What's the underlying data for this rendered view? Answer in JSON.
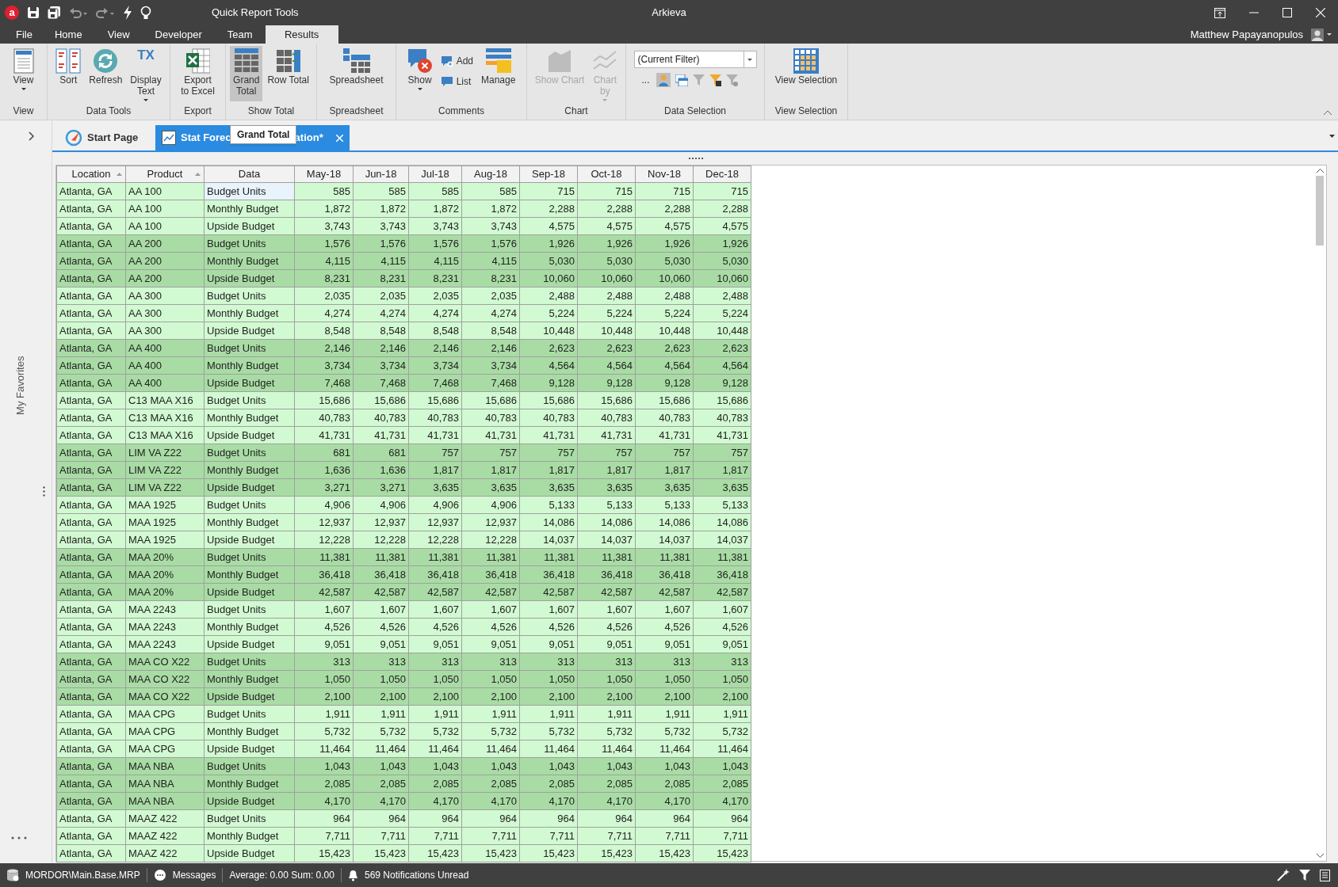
{
  "title_bar": {
    "app_logo": "a",
    "context_title": "Quick Report Tools",
    "title": "Arkieva"
  },
  "menu": [
    {
      "label": "File",
      "selected": false
    },
    {
      "label": "Home",
      "selected": false
    },
    {
      "label": "View",
      "selected": false
    },
    {
      "label": "Developer",
      "selected": false
    },
    {
      "label": "Team",
      "selected": false
    },
    {
      "label": "Results",
      "selected": true
    }
  ],
  "user": {
    "name": "Matthew Papayanopulos"
  },
  "ribbon": [
    {
      "label": "View",
      "buttons": [
        {
          "kind": "large",
          "label": "View",
          "dropdown": true,
          "pressed": false,
          "disabled": false
        }
      ]
    },
    {
      "label": "Data Tools",
      "buttons": [
        {
          "kind": "large",
          "label": "Sort",
          "dropdown": false,
          "pressed": false,
          "disabled": false
        },
        {
          "kind": "large",
          "label": "Refresh",
          "dropdown": false,
          "pressed": false,
          "disabled": false
        },
        {
          "kind": "large",
          "label": "Display\nText",
          "icon_text": "TX",
          "dropdown": true,
          "pressed": false,
          "disabled": false
        }
      ]
    },
    {
      "label": "Export",
      "buttons": [
        {
          "kind": "large",
          "label": "Export\nto Excel",
          "dropdown": false,
          "pressed": false,
          "disabled": false
        }
      ]
    },
    {
      "label": "Show Total",
      "buttons": [
        {
          "kind": "large",
          "label": "Grand\nTotal",
          "dropdown": false,
          "pressed": true,
          "disabled": false
        },
        {
          "kind": "large",
          "label": "Row Total",
          "dropdown": false,
          "pressed": false,
          "disabled": false
        }
      ]
    },
    {
      "label": "Spreadsheet",
      "buttons": [
        {
          "kind": "large",
          "label": "Spreadsheet",
          "dropdown": false,
          "pressed": false,
          "disabled": false
        }
      ]
    },
    {
      "label": "Comments",
      "buttons": [
        {
          "kind": "large",
          "label": "Show",
          "dropdown": true,
          "pressed": false,
          "disabled": false
        },
        {
          "kind": "stack",
          "items": [
            {
              "label": "Add"
            },
            {
              "label": "List"
            }
          ]
        },
        {
          "kind": "large",
          "label": "Manage",
          "dropdown": false,
          "pressed": false,
          "disabled": false
        }
      ]
    },
    {
      "label": "Chart",
      "buttons": [
        {
          "kind": "large",
          "label": "Show Chart",
          "dropdown": false,
          "pressed": false,
          "disabled": true
        },
        {
          "kind": "large",
          "label": "Chart\nby",
          "dropdown": true,
          "pressed": false,
          "disabled": true
        }
      ]
    },
    {
      "label": "Data Selection",
      "buttons": [
        {
          "kind": "filter",
          "value": "(Current Filter)",
          "more": "..."
        }
      ]
    },
    {
      "label": "View Selection",
      "buttons": [
        {
          "kind": "large",
          "label": "View Selection",
          "dropdown": false,
          "pressed": false,
          "disabled": false
        }
      ]
    }
  ],
  "sidebar": {
    "label": "My Favorites"
  },
  "doc_tabs": [
    {
      "label": "Start Page",
      "selected": false,
      "closable": false
    },
    {
      "label": "Stat Forec",
      "label_end": "ation*",
      "selected": true,
      "closable": true
    }
  ],
  "tooltip": "Grand Total",
  "table": {
    "columns": [
      {
        "label": "Location",
        "sorted": true
      },
      {
        "label": "Product",
        "sorted": true
      },
      {
        "label": "Data",
        "sorted": false
      },
      {
        "label": "May-18",
        "sorted": false
      },
      {
        "label": "Jun-18",
        "sorted": false
      },
      {
        "label": "Jul-18",
        "sorted": false
      },
      {
        "label": "Aug-18",
        "sorted": false
      },
      {
        "label": "Sep-18",
        "sorted": false
      },
      {
        "label": "Oct-18",
        "sorted": false
      },
      {
        "label": "Nov-18",
        "sorted": false
      },
      {
        "label": "Dec-18",
        "sorted": false
      }
    ],
    "rows": [
      {
        "location": "Atlanta, GA",
        "product": "AA 100",
        "data": "Budget Units",
        "values": [
          "585",
          "585",
          "585",
          "585",
          "715",
          "715",
          "715",
          "715"
        ],
        "shaded": false,
        "selected": true
      },
      {
        "location": "Atlanta, GA",
        "product": "AA 100",
        "data": "Monthly Budget",
        "values": [
          "1,872",
          "1,872",
          "1,872",
          "1,872",
          "2,288",
          "2,288",
          "2,288",
          "2,288"
        ],
        "shaded": false,
        "selected": false
      },
      {
        "location": "Atlanta, GA",
        "product": "AA 100",
        "data": "Upside Budget",
        "values": [
          "3,743",
          "3,743",
          "3,743",
          "3,743",
          "4,575",
          "4,575",
          "4,575",
          "4,575"
        ],
        "shaded": false,
        "selected": false
      },
      {
        "location": "Atlanta, GA",
        "product": "AA 200",
        "data": "Budget Units",
        "values": [
          "1,576",
          "1,576",
          "1,576",
          "1,576",
          "1,926",
          "1,926",
          "1,926",
          "1,926"
        ],
        "shaded": true,
        "selected": false
      },
      {
        "location": "Atlanta, GA",
        "product": "AA 200",
        "data": "Monthly Budget",
        "values": [
          "4,115",
          "4,115",
          "4,115",
          "4,115",
          "5,030",
          "5,030",
          "5,030",
          "5,030"
        ],
        "shaded": true,
        "selected": false
      },
      {
        "location": "Atlanta, GA",
        "product": "AA 200",
        "data": "Upside Budget",
        "values": [
          "8,231",
          "8,231",
          "8,231",
          "8,231",
          "10,060",
          "10,060",
          "10,060",
          "10,060"
        ],
        "shaded": true,
        "selected": false
      },
      {
        "location": "Atlanta, GA",
        "product": "AA 300",
        "data": "Budget Units",
        "values": [
          "2,035",
          "2,035",
          "2,035",
          "2,035",
          "2,488",
          "2,488",
          "2,488",
          "2,488"
        ],
        "shaded": false,
        "selected": false
      },
      {
        "location": "Atlanta, GA",
        "product": "AA 300",
        "data": "Monthly Budget",
        "values": [
          "4,274",
          "4,274",
          "4,274",
          "4,274",
          "5,224",
          "5,224",
          "5,224",
          "5,224"
        ],
        "shaded": false,
        "selected": false
      },
      {
        "location": "Atlanta, GA",
        "product": "AA 300",
        "data": "Upside Budget",
        "values": [
          "8,548",
          "8,548",
          "8,548",
          "8,548",
          "10,448",
          "10,448",
          "10,448",
          "10,448"
        ],
        "shaded": false,
        "selected": false
      },
      {
        "location": "Atlanta, GA",
        "product": "AA 400",
        "data": "Budget Units",
        "values": [
          "2,146",
          "2,146",
          "2,146",
          "2,146",
          "2,623",
          "2,623",
          "2,623",
          "2,623"
        ],
        "shaded": true,
        "selected": false
      },
      {
        "location": "Atlanta, GA",
        "product": "AA 400",
        "data": "Monthly Budget",
        "values": [
          "3,734",
          "3,734",
          "3,734",
          "3,734",
          "4,564",
          "4,564",
          "4,564",
          "4,564"
        ],
        "shaded": true,
        "selected": false
      },
      {
        "location": "Atlanta, GA",
        "product": "AA 400",
        "data": "Upside Budget",
        "values": [
          "7,468",
          "7,468",
          "7,468",
          "7,468",
          "9,128",
          "9,128",
          "9,128",
          "9,128"
        ],
        "shaded": true,
        "selected": false
      },
      {
        "location": "Atlanta, GA",
        "product": "C13 MAA X16",
        "data": "Budget Units",
        "values": [
          "15,686",
          "15,686",
          "15,686",
          "15,686",
          "15,686",
          "15,686",
          "15,686",
          "15,686"
        ],
        "shaded": false,
        "selected": false
      },
      {
        "location": "Atlanta, GA",
        "product": "C13 MAA X16",
        "data": "Monthly Budget",
        "values": [
          "40,783",
          "40,783",
          "40,783",
          "40,783",
          "40,783",
          "40,783",
          "40,783",
          "40,783"
        ],
        "shaded": false,
        "selected": false
      },
      {
        "location": "Atlanta, GA",
        "product": "C13 MAA X16",
        "data": "Upside Budget",
        "values": [
          "41,731",
          "41,731",
          "41,731",
          "41,731",
          "41,731",
          "41,731",
          "41,731",
          "41,731"
        ],
        "shaded": false,
        "selected": false
      },
      {
        "location": "Atlanta, GA",
        "product": "LIM VA Z22",
        "data": "Budget Units",
        "values": [
          "681",
          "681",
          "757",
          "757",
          "757",
          "757",
          "757",
          "757"
        ],
        "shaded": true,
        "selected": false
      },
      {
        "location": "Atlanta, GA",
        "product": "LIM VA Z22",
        "data": "Monthly Budget",
        "values": [
          "1,636",
          "1,636",
          "1,817",
          "1,817",
          "1,817",
          "1,817",
          "1,817",
          "1,817"
        ],
        "shaded": true,
        "selected": false
      },
      {
        "location": "Atlanta, GA",
        "product": "LIM VA Z22",
        "data": "Upside Budget",
        "values": [
          "3,271",
          "3,271",
          "3,635",
          "3,635",
          "3,635",
          "3,635",
          "3,635",
          "3,635"
        ],
        "shaded": true,
        "selected": false
      },
      {
        "location": "Atlanta, GA",
        "product": "MAA 1925",
        "data": "Budget Units",
        "values": [
          "4,906",
          "4,906",
          "4,906",
          "4,906",
          "5,133",
          "5,133",
          "5,133",
          "5,133"
        ],
        "shaded": false,
        "selected": false
      },
      {
        "location": "Atlanta, GA",
        "product": "MAA 1925",
        "data": "Monthly Budget",
        "values": [
          "12,937",
          "12,937",
          "12,937",
          "12,937",
          "14,086",
          "14,086",
          "14,086",
          "14,086"
        ],
        "shaded": false,
        "selected": false
      },
      {
        "location": "Atlanta, GA",
        "product": "MAA 1925",
        "data": "Upside Budget",
        "values": [
          "12,228",
          "12,228",
          "12,228",
          "12,228",
          "14,037",
          "14,037",
          "14,037",
          "14,037"
        ],
        "shaded": false,
        "selected": false
      },
      {
        "location": "Atlanta, GA",
        "product": "MAA 20%",
        "data": "Budget Units",
        "values": [
          "11,381",
          "11,381",
          "11,381",
          "11,381",
          "11,381",
          "11,381",
          "11,381",
          "11,381"
        ],
        "shaded": true,
        "selected": false
      },
      {
        "location": "Atlanta, GA",
        "product": "MAA 20%",
        "data": "Monthly Budget",
        "values": [
          "36,418",
          "36,418",
          "36,418",
          "36,418",
          "36,418",
          "36,418",
          "36,418",
          "36,418"
        ],
        "shaded": true,
        "selected": false
      },
      {
        "location": "Atlanta, GA",
        "product": "MAA 20%",
        "data": "Upside Budget",
        "values": [
          "42,587",
          "42,587",
          "42,587",
          "42,587",
          "42,587",
          "42,587",
          "42,587",
          "42,587"
        ],
        "shaded": true,
        "selected": false
      },
      {
        "location": "Atlanta, GA",
        "product": "MAA 2243",
        "data": "Budget Units",
        "values": [
          "1,607",
          "1,607",
          "1,607",
          "1,607",
          "1,607",
          "1,607",
          "1,607",
          "1,607"
        ],
        "shaded": false,
        "selected": false
      },
      {
        "location": "Atlanta, GA",
        "product": "MAA 2243",
        "data": "Monthly Budget",
        "values": [
          "4,526",
          "4,526",
          "4,526",
          "4,526",
          "4,526",
          "4,526",
          "4,526",
          "4,526"
        ],
        "shaded": false,
        "selected": false
      },
      {
        "location": "Atlanta, GA",
        "product": "MAA 2243",
        "data": "Upside Budget",
        "values": [
          "9,051",
          "9,051",
          "9,051",
          "9,051",
          "9,051",
          "9,051",
          "9,051",
          "9,051"
        ],
        "shaded": false,
        "selected": false
      },
      {
        "location": "Atlanta, GA",
        "product": "MAA CO X22",
        "data": "Budget Units",
        "values": [
          "313",
          "313",
          "313",
          "313",
          "313",
          "313",
          "313",
          "313"
        ],
        "shaded": true,
        "selected": false
      },
      {
        "location": "Atlanta, GA",
        "product": "MAA CO X22",
        "data": "Monthly Budget",
        "values": [
          "1,050",
          "1,050",
          "1,050",
          "1,050",
          "1,050",
          "1,050",
          "1,050",
          "1,050"
        ],
        "shaded": true,
        "selected": false
      },
      {
        "location": "Atlanta, GA",
        "product": "MAA CO X22",
        "data": "Upside Budget",
        "values": [
          "2,100",
          "2,100",
          "2,100",
          "2,100",
          "2,100",
          "2,100",
          "2,100",
          "2,100"
        ],
        "shaded": true,
        "selected": false
      },
      {
        "location": "Atlanta, GA",
        "product": "MAA CPG",
        "data": "Budget Units",
        "values": [
          "1,911",
          "1,911",
          "1,911",
          "1,911",
          "1,911",
          "1,911",
          "1,911",
          "1,911"
        ],
        "shaded": false,
        "selected": false
      },
      {
        "location": "Atlanta, GA",
        "product": "MAA CPG",
        "data": "Monthly Budget",
        "values": [
          "5,732",
          "5,732",
          "5,732",
          "5,732",
          "5,732",
          "5,732",
          "5,732",
          "5,732"
        ],
        "shaded": false,
        "selected": false
      },
      {
        "location": "Atlanta, GA",
        "product": "MAA CPG",
        "data": "Upside Budget",
        "values": [
          "11,464",
          "11,464",
          "11,464",
          "11,464",
          "11,464",
          "11,464",
          "11,464",
          "11,464"
        ],
        "shaded": false,
        "selected": false
      },
      {
        "location": "Atlanta, GA",
        "product": "MAA NBA",
        "data": "Budget Units",
        "values": [
          "1,043",
          "1,043",
          "1,043",
          "1,043",
          "1,043",
          "1,043",
          "1,043",
          "1,043"
        ],
        "shaded": true,
        "selected": false
      },
      {
        "location": "Atlanta, GA",
        "product": "MAA NBA",
        "data": "Monthly Budget",
        "values": [
          "2,085",
          "2,085",
          "2,085",
          "2,085",
          "2,085",
          "2,085",
          "2,085",
          "2,085"
        ],
        "shaded": true,
        "selected": false
      },
      {
        "location": "Atlanta, GA",
        "product": "MAA NBA",
        "data": "Upside Budget",
        "values": [
          "4,170",
          "4,170",
          "4,170",
          "4,170",
          "4,170",
          "4,170",
          "4,170",
          "4,170"
        ],
        "shaded": true,
        "selected": false
      },
      {
        "location": "Atlanta, GA",
        "product": "MAAZ 422",
        "data": "Budget Units",
        "values": [
          "964",
          "964",
          "964",
          "964",
          "964",
          "964",
          "964",
          "964"
        ],
        "shaded": false,
        "selected": false
      },
      {
        "location": "Atlanta, GA",
        "product": "MAAZ 422",
        "data": "Monthly Budget",
        "values": [
          "7,711",
          "7,711",
          "7,711",
          "7,711",
          "7,711",
          "7,711",
          "7,711",
          "7,711"
        ],
        "shaded": false,
        "selected": false
      },
      {
        "location": "Atlanta, GA",
        "product": "MAAZ 422",
        "data": "Upside Budget",
        "values": [
          "15,423",
          "15,423",
          "15,423",
          "15,423",
          "15,423",
          "15,423",
          "15,423",
          "15,423"
        ],
        "shaded": false,
        "selected": false
      }
    ]
  },
  "status_bar": [
    {
      "text": "MORDOR\\Main.Base.MRP"
    },
    {
      "text": "Messages"
    },
    {
      "text": "Average: 0.00 Sum: 0.00"
    },
    {
      "text": "569 Notifications Unread"
    }
  ]
}
